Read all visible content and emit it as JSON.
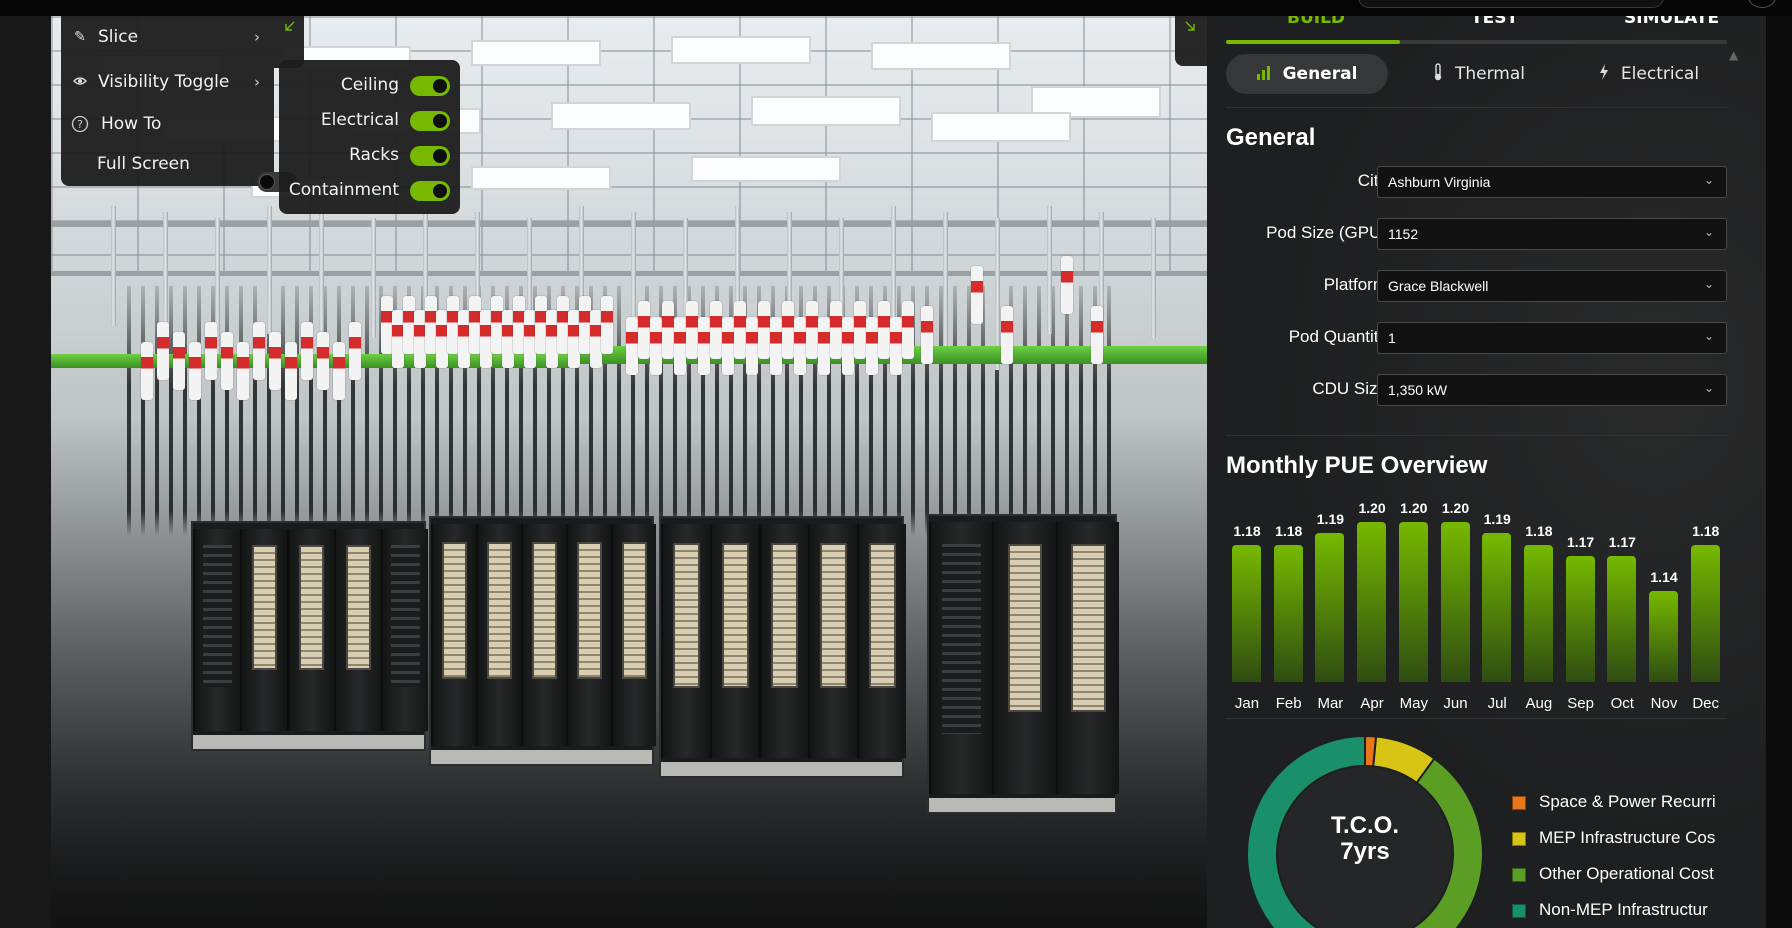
{
  "viewer_menu": {
    "items": [
      {
        "label": "Slice",
        "icon": "pencil-icon",
        "has_submenu": true
      },
      {
        "label": "Visibility Toggle",
        "icon": "eye-icon",
        "has_submenu": true
      },
      {
        "label": "How To",
        "icon": "help-circle-icon",
        "has_submenu": false
      }
    ],
    "full_screen": {
      "label": "Full Screen",
      "on": false
    }
  },
  "visibility": [
    {
      "label": "Ceiling",
      "on": true
    },
    {
      "label": "Electrical",
      "on": true
    },
    {
      "label": "Racks",
      "on": true
    },
    {
      "label": "Containment",
      "on": true
    }
  ],
  "tabs": [
    {
      "label": "BUILD",
      "active": true
    },
    {
      "label": "TEST",
      "active": false
    },
    {
      "label": "SIMULATE",
      "active": false
    }
  ],
  "subtabs": [
    {
      "label": "General",
      "icon": "bar-chart-icon",
      "active": true
    },
    {
      "label": "Thermal",
      "icon": "thermometer-icon",
      "active": false
    },
    {
      "label": "Electrical",
      "icon": "lightning-icon",
      "active": false
    }
  ],
  "general": {
    "title": "General",
    "fields": [
      {
        "label": "City",
        "value": "Ashburn Virginia"
      },
      {
        "label": "Pod Size (GPU)",
        "value": "1152"
      },
      {
        "label": "Platform",
        "value": "Grace Blackwell"
      },
      {
        "label": "Pod Quantity",
        "value": "1"
      },
      {
        "label": "CDU Size",
        "value": "1,350 kW"
      }
    ]
  },
  "pue": {
    "title": "Monthly PUE Overview"
  },
  "tco": {
    "center_line1": "T.C.O.",
    "center_line2": "7yrs"
  },
  "chart_data": [
    {
      "type": "bar",
      "title": "Monthly PUE Overview",
      "categories": [
        "Jan",
        "Feb",
        "Mar",
        "Apr",
        "May",
        "Jun",
        "Jul",
        "Aug",
        "Sep",
        "Oct",
        "Nov",
        "Dec"
      ],
      "values": [
        1.18,
        1.18,
        1.19,
        1.2,
        1.2,
        1.2,
        1.19,
        1.18,
        1.17,
        1.17,
        1.14,
        1.18
      ],
      "value_labels": [
        "1.18",
        "1.18",
        "1.19",
        "1.20",
        "1.20",
        "1.20",
        "1.19",
        "1.18",
        "1.17",
        "1.17",
        "1.14",
        "1.18"
      ],
      "ylim": [
        1.06,
        1.2
      ],
      "grid": false,
      "bar_color": "#76b900"
    },
    {
      "type": "pie",
      "subtype": "donut",
      "center_text": "T.C.O. 7yrs",
      "legend_position": "right",
      "slices": [
        {
          "label": "Space & Power Recurri",
          "value": 0.015,
          "color": "#e8761a"
        },
        {
          "label": "MEP Infrastructure Cos",
          "value": 0.085,
          "color": "#d8c414"
        },
        {
          "label": "Other Operational Cost",
          "value": 0.31,
          "color": "#5a9e23"
        },
        {
          "label": "Non-MEP Infrastructur",
          "value": 0.59,
          "color": "#1a8f6b"
        }
      ]
    }
  ],
  "colors": {
    "accent": "#76b900",
    "panel_bg": "#1e1f20",
    "field_bg": "#121212"
  }
}
